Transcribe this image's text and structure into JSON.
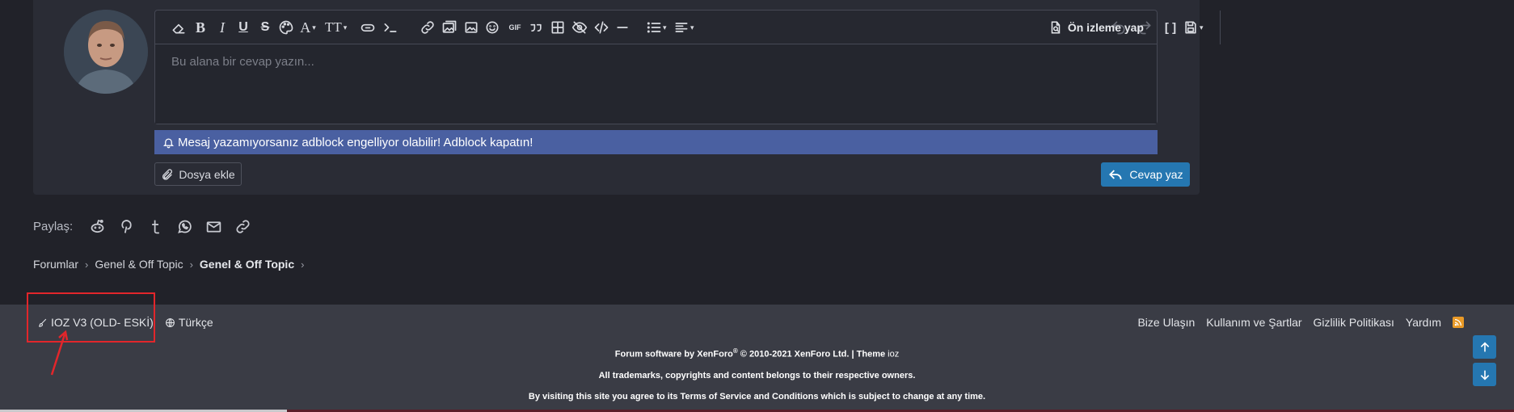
{
  "editor": {
    "placeholder": "Bu alana bir cevap yazın...",
    "preview_label": "Ön izleme yap",
    "toolbar_icons": [
      "eraser-icon",
      "bold-icon",
      "italic-icon",
      "underline-icon",
      "strike-icon",
      "palette-icon",
      "font-color-icon",
      "font-size-icon",
      "mention-icon",
      "code-inline-icon",
      "link-icon",
      "image-gallery-icon",
      "image-icon",
      "emoji-icon",
      "gif-icon",
      "quote-icon",
      "table-icon",
      "spoiler-icon",
      "code-icon",
      "hr-icon",
      "list-icon",
      "align-icon",
      "undo-icon",
      "redo-icon",
      "bbcode-icon",
      "draft-icon"
    ],
    "gif_label": "GIF"
  },
  "notice": {
    "adblock_text": "Mesaj yazamıyorsanız adblock engelliyor olabilir! Adblock kapatın!"
  },
  "actions": {
    "attach_label": "Dosya ekle",
    "reply_label": "Cevap yaz"
  },
  "share": {
    "label": "Paylaş:",
    "icons": [
      "reddit-icon",
      "pinterest-icon",
      "tumblr-icon",
      "whatsapp-icon",
      "email-icon",
      "link-icon"
    ]
  },
  "breadcrumb": {
    "items": [
      "Forumlar",
      "Genel & Off Topic",
      "Genel & Off Topic"
    ]
  },
  "footer": {
    "style_chooser": "IOZ V3 (OLD- ESKİ)",
    "language": "Türkçe",
    "links": [
      "Bize Ulaşın",
      "Kullanım ve Şartlar",
      "Gizlilik Politikası",
      "Yardım"
    ],
    "line1_a": "Forum software by XenForo",
    "line1_reg": "®",
    "line1_b": " © 2010-2021 XenForo Ltd. | Theme ",
    "line1_theme": "ioz",
    "line2": "All trademarks, copyrights and content belongs to their respective owners.",
    "line3": "By visiting this site you agree to its Terms of Service and Conditions which is subject to change at any time."
  },
  "colors": {
    "background": "#212229",
    "notice": "#4a60a1",
    "primary_button": "#2577b1",
    "footer": "#3a3c45",
    "highlight": "#e2262b",
    "rss": "#e99a27"
  }
}
